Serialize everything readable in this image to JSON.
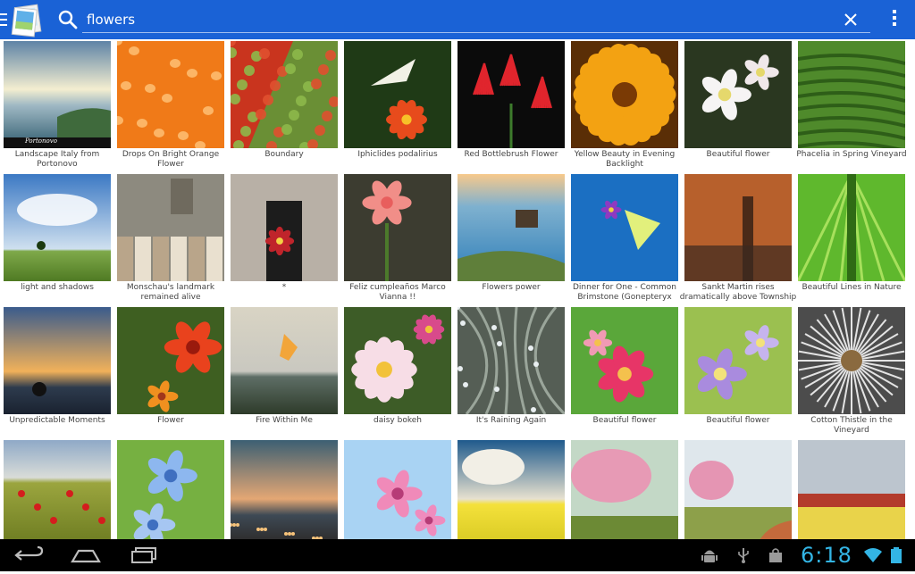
{
  "search": {
    "query": "flowers"
  },
  "photos": [
    {
      "caption": "Landscape Italy from Portonovo",
      "watermark": "Portonovo"
    },
    {
      "caption": "Drops On Bright Orange Flower"
    },
    {
      "caption": "Boundary"
    },
    {
      "caption": "Iphiclides podalirius"
    },
    {
      "caption": "Red Bottlebrush Flower"
    },
    {
      "caption": "Yellow Beauty in Evening Backlight"
    },
    {
      "caption": "Beautiful flower"
    },
    {
      "caption": "Phacelia in Spring Vineyard"
    },
    {
      "caption": "light and shadows"
    },
    {
      "caption": "Monschau's landmark remained alive"
    },
    {
      "caption": "*"
    },
    {
      "caption": "Feliz cumpleaños Marco Vianna !!"
    },
    {
      "caption": "Flowers power"
    },
    {
      "caption": "Dinner for One - Common Brimstone (Gonepteryx"
    },
    {
      "caption": "Sankt Martin rises dramatically above Township"
    },
    {
      "caption": "Beautiful Lines in Nature"
    },
    {
      "caption": "Unpredictable Moments"
    },
    {
      "caption": "Flower"
    },
    {
      "caption": "Fire Within Me"
    },
    {
      "caption": "daisy bokeh"
    },
    {
      "caption": "It's Raining Again"
    },
    {
      "caption": "Beautiful flower"
    },
    {
      "caption": "Beautiful flower"
    },
    {
      "caption": "Cotton Thistle in the Vineyard"
    },
    {
      "caption": ""
    },
    {
      "caption": ""
    },
    {
      "caption": ""
    },
    {
      "caption": ""
    },
    {
      "caption": ""
    },
    {
      "caption": ""
    },
    {
      "caption": ""
    },
    {
      "caption": ""
    }
  ],
  "status": {
    "time": "6:18"
  },
  "icons": {
    "drawer": "menu-icon",
    "app": "gallery-app-icon",
    "search": "search-icon",
    "clear": "close-icon",
    "overflow": "overflow-menu-icon",
    "back": "back-icon",
    "home": "home-icon",
    "recents": "recent-apps-icon",
    "android": "android-debug-icon",
    "usb": "usb-icon",
    "store": "shopping-bag-icon",
    "wifi": "wifi-icon",
    "battery": "battery-icon"
  },
  "colors": {
    "action_bar": "#1a62d6",
    "clock": "#33b5e5"
  }
}
